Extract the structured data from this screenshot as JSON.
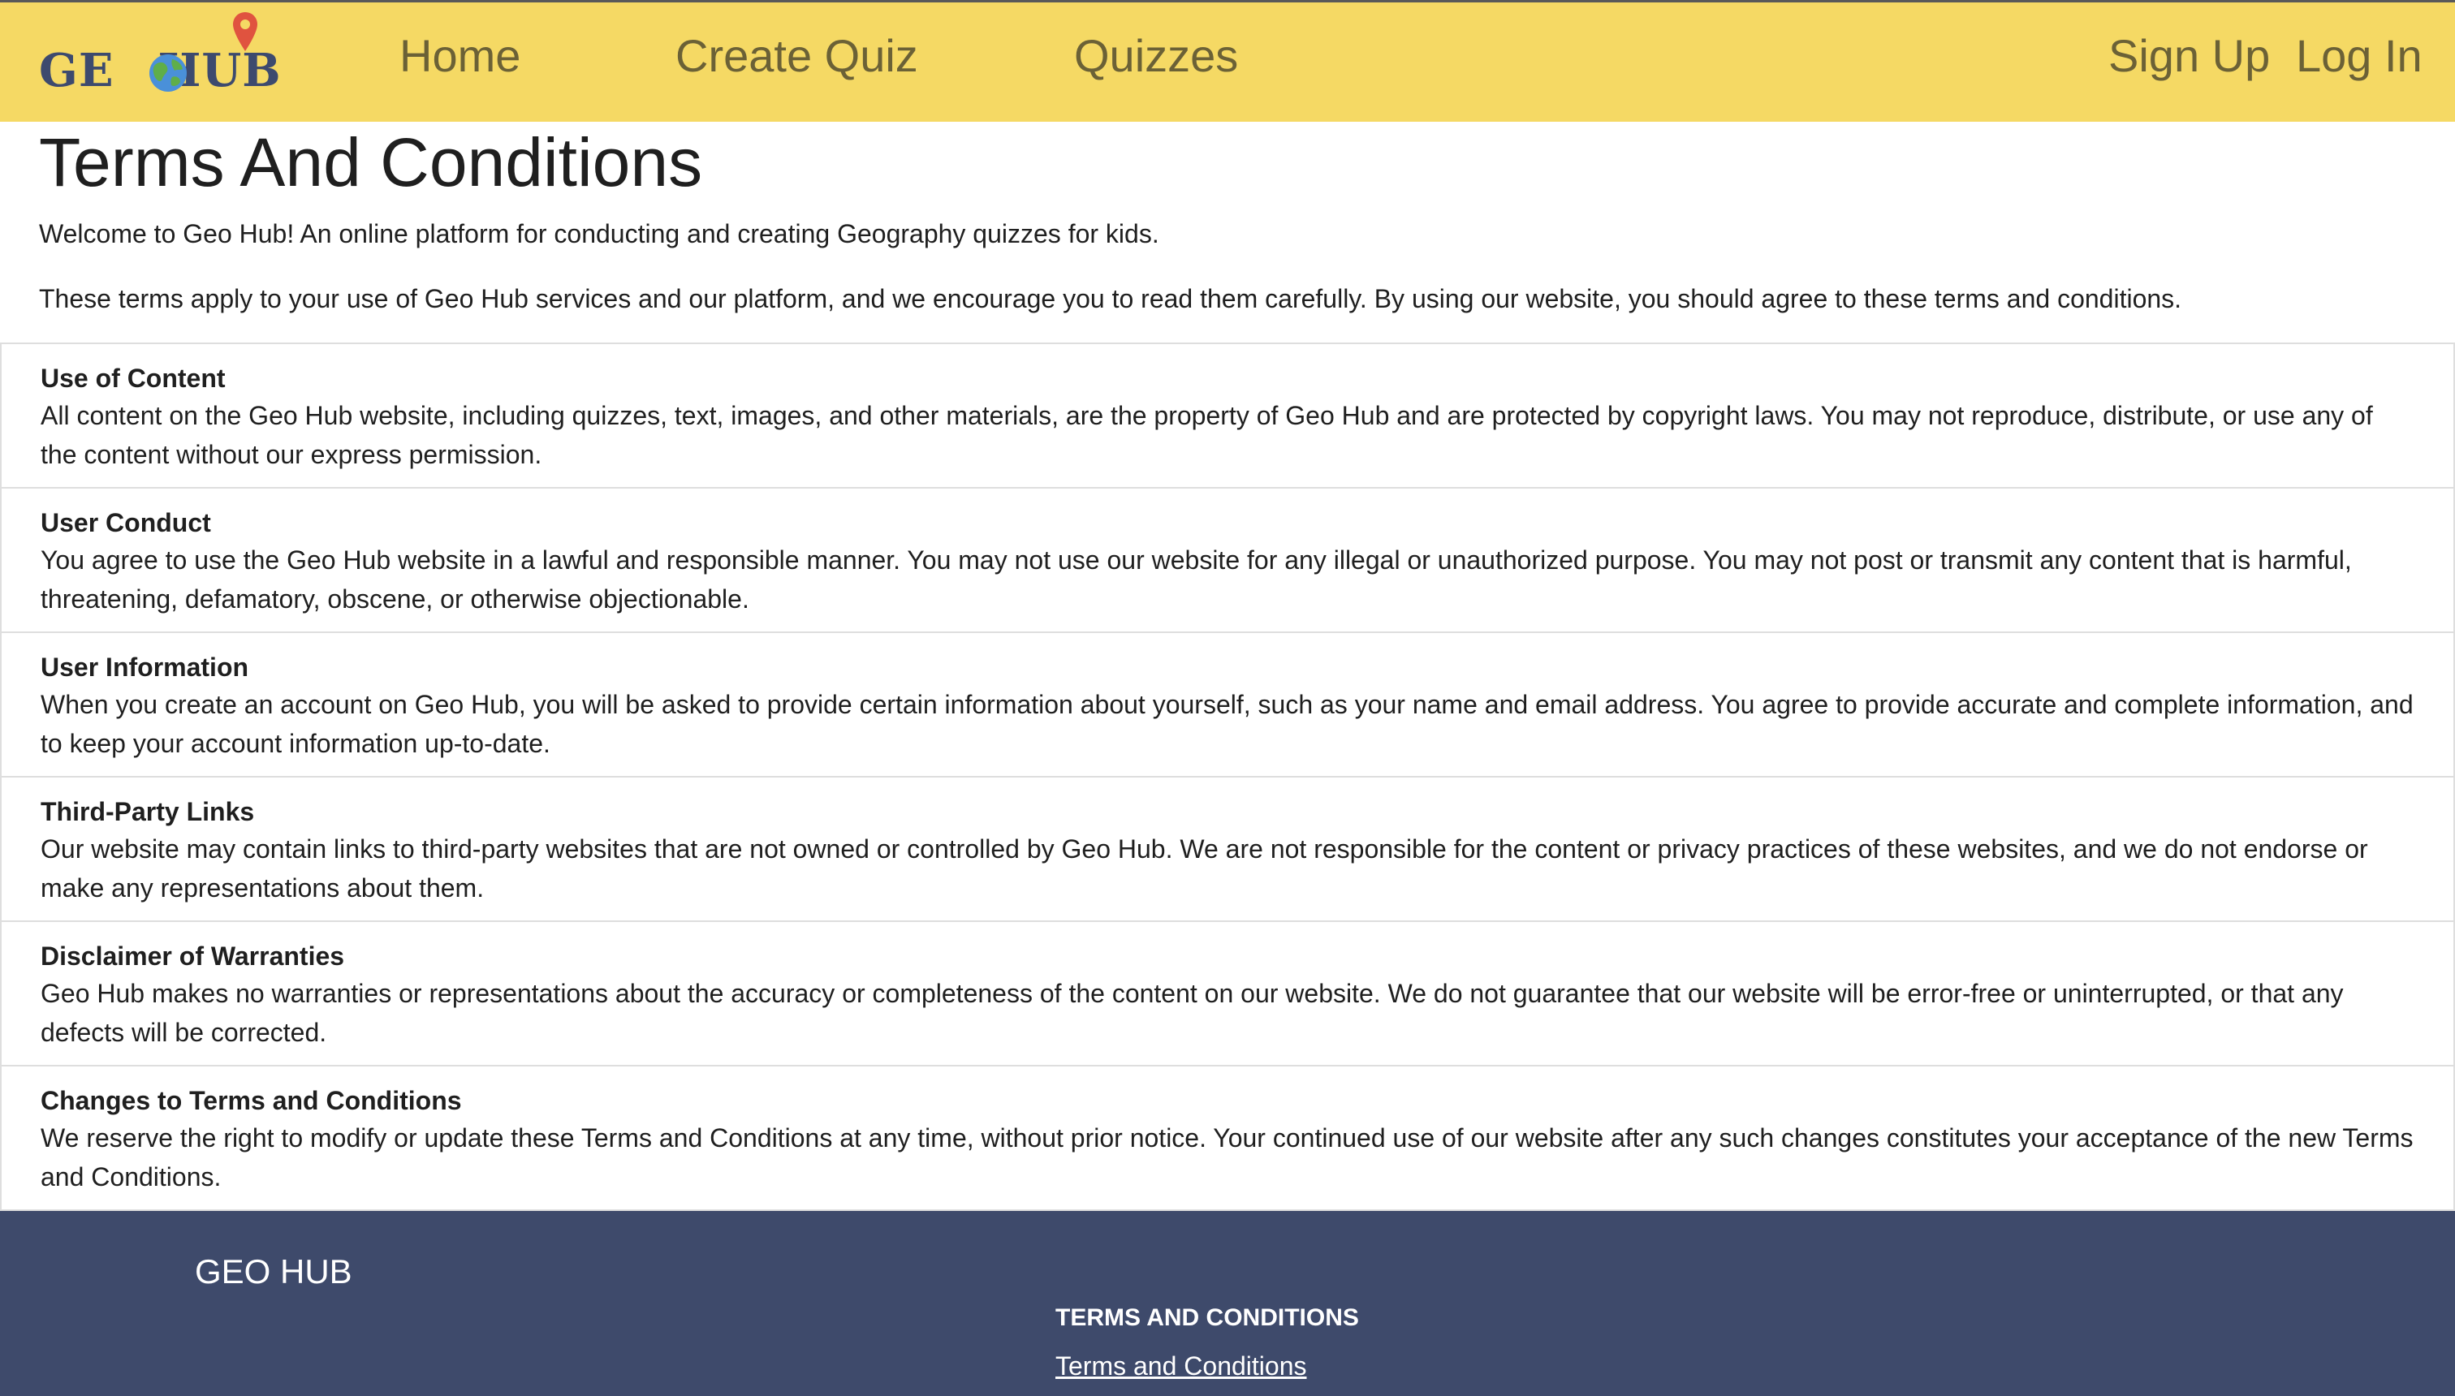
{
  "navbar": {
    "logo_left": "GE",
    "logo_right": "HUB",
    "links": {
      "home": "Home",
      "create_quiz": "Create Quiz",
      "quizzes": "Quizzes",
      "sign_up": "Sign Up",
      "log_in": "Log In"
    },
    "background": "#f5d964",
    "link_color": "#6b6136"
  },
  "main": {
    "title": "Terms And Conditions",
    "intro": [
      "Welcome to Geo Hub! An online platform for conducting and creating Geography quizzes for kids.",
      "These terms apply to your use of Geo Hub services and our platform, and we encourage you to read them carefully. By using our website, you should agree to these terms and conditions."
    ],
    "sections": [
      {
        "title": "Use of Content",
        "body": "All content on the Geo Hub website, including quizzes, text, images, and other materials, are the property of Geo Hub and are protected by copyright laws. You may not reproduce, distribute, or use any of the content without our express permission."
      },
      {
        "title": "User Conduct",
        "body": "You agree to use the Geo Hub website in a lawful and responsible manner. You may not use our website for any illegal or unauthorized purpose. You may not post or transmit any content that is harmful, threatening, defamatory, obscene, or otherwise objectionable."
      },
      {
        "title": "User Information",
        "body": "When you create an account on Geo Hub, you will be asked to provide certain information about yourself, such as your name and email address. You agree to provide accurate and complete information, and to keep your account information up-to-date."
      },
      {
        "title": "Third-Party Links",
        "body": "Our website may contain links to third-party websites that are not owned or controlled by Geo Hub. We are not responsible for the content or privacy practices of these websites, and we do not endorse or make any representations about them."
      },
      {
        "title": "Disclaimer of Warranties",
        "body": "Geo Hub makes no warranties or representations about the accuracy or completeness of the content on our website. We do not guarantee that our website will be error-free or uninterrupted, or that any defects will be corrected."
      },
      {
        "title": "Changes to Terms and Conditions",
        "body": "We reserve the right to modify or update these Terms and Conditions at any time, without prior notice. Your continued use of our website after any such changes constitutes your acceptance of the new Terms and Conditions."
      }
    ]
  },
  "footer": {
    "brand": "GEO HUB",
    "heading": "TERMS AND CONDITIONS",
    "link": "Terms and Conditions",
    "background": "#3e4a6b"
  },
  "icons": {
    "logo_globe": "globe-icon",
    "logo_pin": "map-pin-icon"
  }
}
